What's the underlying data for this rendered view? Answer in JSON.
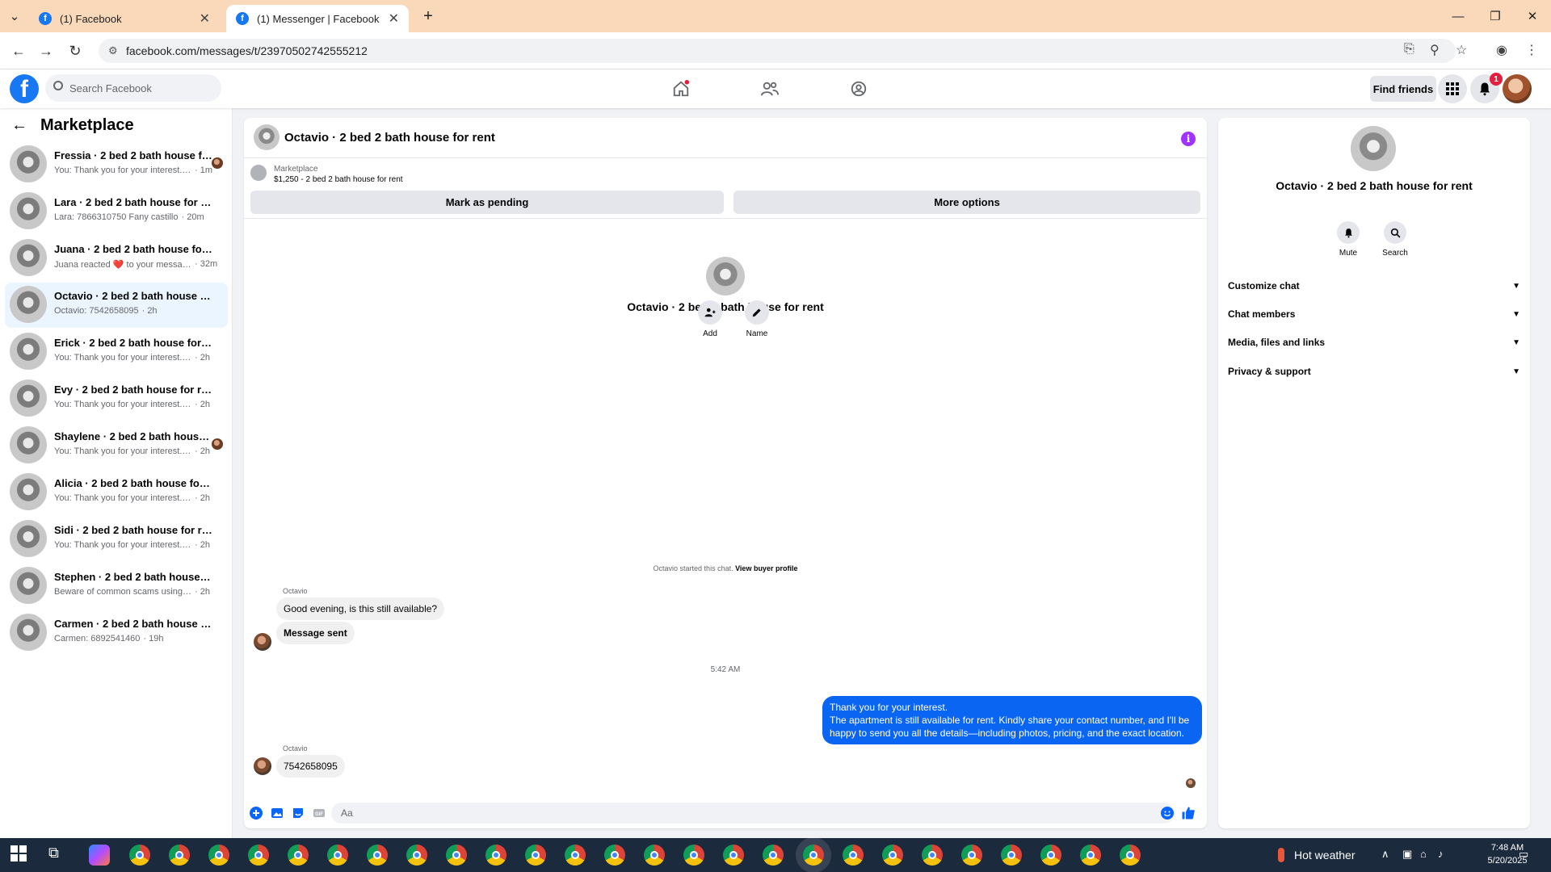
{
  "browser": {
    "tabs": [
      {
        "title": "(1) Facebook",
        "active": false
      },
      {
        "title": "(1) Messenger | Facebook",
        "active": true
      }
    ],
    "url": "facebook.com/messages/t/23970502742555212"
  },
  "header": {
    "search_placeholder": "Search Facebook",
    "find_friends": "Find friends",
    "notification_count": "1",
    "brand_color": "#1877f2"
  },
  "sidebar": {
    "title": "Marketplace",
    "conversations": [
      {
        "name": "Fressia · 2 bed 2 bath house for ...",
        "preview": "You: Thank you for your interest. T...",
        "time": "· 1m",
        "read_receipt": true
      },
      {
        "name": "Lara · 2 bed 2 bath house for rent",
        "preview": "Lara: 7866310750 Fany castillo",
        "time": "· 20m"
      },
      {
        "name": "Juana · 2 bed 2 bath house for rent",
        "preview": "Juana reacted ❤️ to your message",
        "time": "· 32m"
      },
      {
        "name": "Octavio · 2 bed 2 bath house for r...",
        "preview": "Octavio: 7542658095",
        "time": "· 2h",
        "selected": true
      },
      {
        "name": "Erick · 2 bed 2 bath house for rent",
        "preview": "You: Thank you for your interest. The ...",
        "time": "· 2h"
      },
      {
        "name": "Evy · 2 bed 2 bath house for rent",
        "preview": "You: Thank you for your interest. The ...",
        "time": "· 2h"
      },
      {
        "name": "Shaylene · 2 bed 2 bath house f...",
        "preview": "You: Thank you for your interest. Th...",
        "time": "· 2h",
        "read_receipt": true
      },
      {
        "name": "Alicia · 2 bed 2 bath house for rent",
        "preview": "You: Thank you for your interest. The ...",
        "time": "· 2h"
      },
      {
        "name": "Sidi · 2 bed 2 bath house for rent",
        "preview": "You: Thank you for your interest. The ...",
        "time": "· 2h"
      },
      {
        "name": "Stephen · 2 bed 2 bath house for r...",
        "preview": "Beware of common scams using pay...",
        "time": "· 2h"
      },
      {
        "name": "Carmen · 2 bed 2 bath house for r...",
        "preview": "Carmen: 6892541460",
        "time": "· 19h"
      }
    ]
  },
  "chat": {
    "title": "Octavio · 2 bed 2 bath house for rent",
    "listing_source": "Marketplace",
    "listing_desc": "$1,250 - 2 bed 2 bath house for rent",
    "mark_pending": "Mark as pending",
    "more_options": "More options",
    "intro_name": "Octavio · 2 bed 2 bath house for rent",
    "add_label": "Add",
    "name_label": "Name",
    "started_text": "Octavio started this chat.",
    "view_profile": "View buyer profile",
    "messages": [
      {
        "sender": "Octavio",
        "text": "Good evening, is this still available?"
      },
      {
        "text": "Message sent"
      },
      {
        "timestamp": "5:42 AM"
      },
      {
        "outgoing_line1": "Thank you for your interest.",
        "outgoing_line2": "The apartment is still available for rent. Kindly share your contact number, and I'll be happy to send you all the details—including photos, pricing, and the exact location."
      },
      {
        "sender": "Octavio",
        "text": "7542658095"
      }
    ],
    "input_placeholder": "Aa",
    "outgoing_color": "#0b65f3"
  },
  "info_panel": {
    "title": "Octavio · 2 bed 2 bath house for rent",
    "mute": "Mute",
    "search": "Search",
    "sections": [
      "Customize chat",
      "Chat members",
      "Media, files and links",
      "Privacy & support"
    ]
  },
  "taskbar": {
    "weather": "Hot weather",
    "time": "7:48 AM",
    "date": "5/20/2025"
  }
}
